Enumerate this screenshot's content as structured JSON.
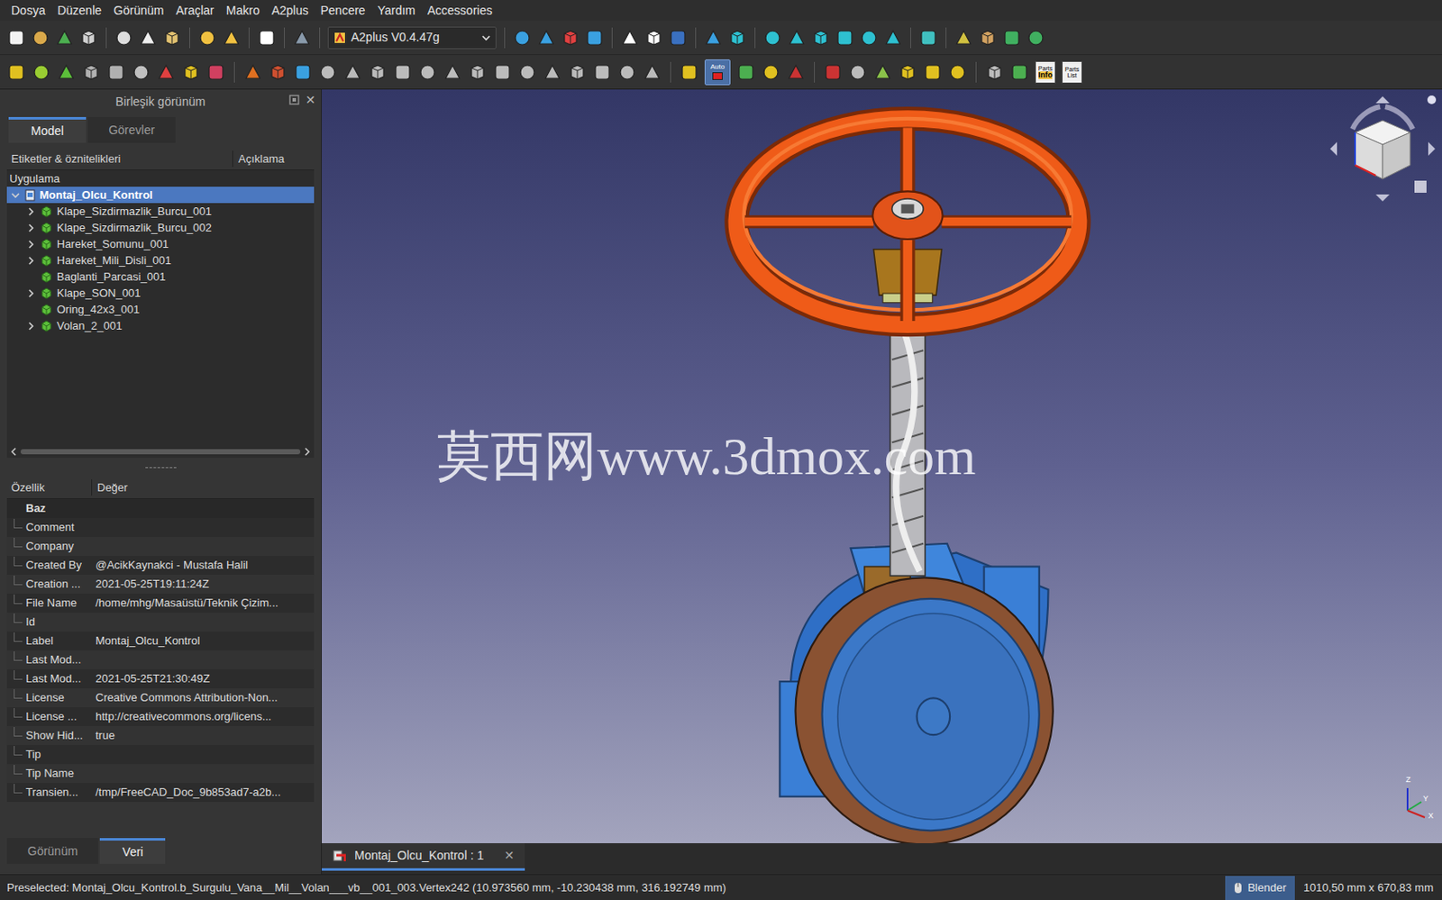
{
  "menu": [
    "Dosya",
    "Düzenle",
    "Görünüm",
    "Araçlar",
    "Makro",
    "A2plus",
    "Pencere",
    "Yardım",
    "Accessories"
  ],
  "toolbar": {
    "workbench": "A2plus V0.4.47g",
    "auto_label": "Auto",
    "auto_on": true,
    "parts_info": [
      "Parts",
      "Info"
    ],
    "parts_list": [
      "Parts",
      "List"
    ]
  },
  "combo_view": {
    "title": "Birleşik görünüm",
    "close": "✕"
  },
  "panel_tabs": [
    {
      "label": "Model",
      "selected": true
    },
    {
      "label": "Görevler",
      "selected": false
    }
  ],
  "tree": {
    "columns": [
      "Etiketler & öznitelikleri",
      "Açıklama"
    ],
    "section": "Uygulama",
    "root": {
      "label": "Montaj_Olcu_Kontrol",
      "expanded": true,
      "selected": true
    },
    "items": [
      {
        "label": "Klape_Sizdirmazlik_Burcu_001",
        "expandable": true,
        "expanded": false
      },
      {
        "label": "Klape_Sizdirmazlik_Burcu_002",
        "expandable": true,
        "expanded": false
      },
      {
        "label": "Hareket_Somunu_001",
        "expandable": true,
        "expanded": false
      },
      {
        "label": "Hareket_Mili_Disli_001",
        "expandable": true,
        "expanded": false
      },
      {
        "label": "Baglanti_Parcasi_001",
        "expandable": false,
        "expanded": false
      },
      {
        "label": "Klape_SON_001",
        "expandable": true,
        "expanded": false
      },
      {
        "label": "Oring_42x3_001",
        "expandable": false,
        "expanded": false
      },
      {
        "label": "Volan_2_001",
        "expandable": true,
        "expanded": false
      }
    ]
  },
  "properties": {
    "columns": [
      "Özellik",
      "Değer"
    ],
    "group": "Baz",
    "rows": [
      {
        "name": "Comment",
        "value": ""
      },
      {
        "name": "Company",
        "value": ""
      },
      {
        "name": "Created By",
        "value": "@AcikKaynakci - Mustafa Halil"
      },
      {
        "name": "Creation ...",
        "value": "2021-05-25T19:11:24Z"
      },
      {
        "name": "File Name",
        "value": "/home/mhg/Masaüstü/Teknik Çizim..."
      },
      {
        "name": "Id",
        "value": ""
      },
      {
        "name": "Label",
        "value": "Montaj_Olcu_Kontrol"
      },
      {
        "name": "Last Mod...",
        "value": ""
      },
      {
        "name": "Last Mod...",
        "value": "2021-05-25T21:30:49Z"
      },
      {
        "name": "License",
        "value": "Creative Commons Attribution-Non..."
      },
      {
        "name": "License ...",
        "value": "http://creativecommons.org/licens..."
      },
      {
        "name": "Show Hid...",
        "value": "true"
      },
      {
        "name": "Tip",
        "value": ""
      },
      {
        "name": "Tip Name",
        "value": ""
      },
      {
        "name": "Transien...",
        "value": "/tmp/FreeCAD_Doc_9b853ad7-a2b..."
      }
    ]
  },
  "bottom_tabs": [
    {
      "label": "Görünüm",
      "selected": false
    },
    {
      "label": "Veri",
      "selected": true
    }
  ],
  "watermark": "莫西网www.3dmox.com",
  "axes": [
    "Z",
    "Y",
    "X"
  ],
  "document_tab": {
    "label": "Montaj_Olcu_Kontrol : 1",
    "close": "✕"
  },
  "status_bar": {
    "message": "Preselected: Montaj_Olcu_Kontrol.b_Surgulu_Vana__Mil__Volan___vb__001_003.Vertex242 (10.973560 mm, -10.230438 mm, 316.192749 mm)",
    "nav_style": "Blender",
    "dimensions": "1010,50 mm x 670,83 mm"
  }
}
